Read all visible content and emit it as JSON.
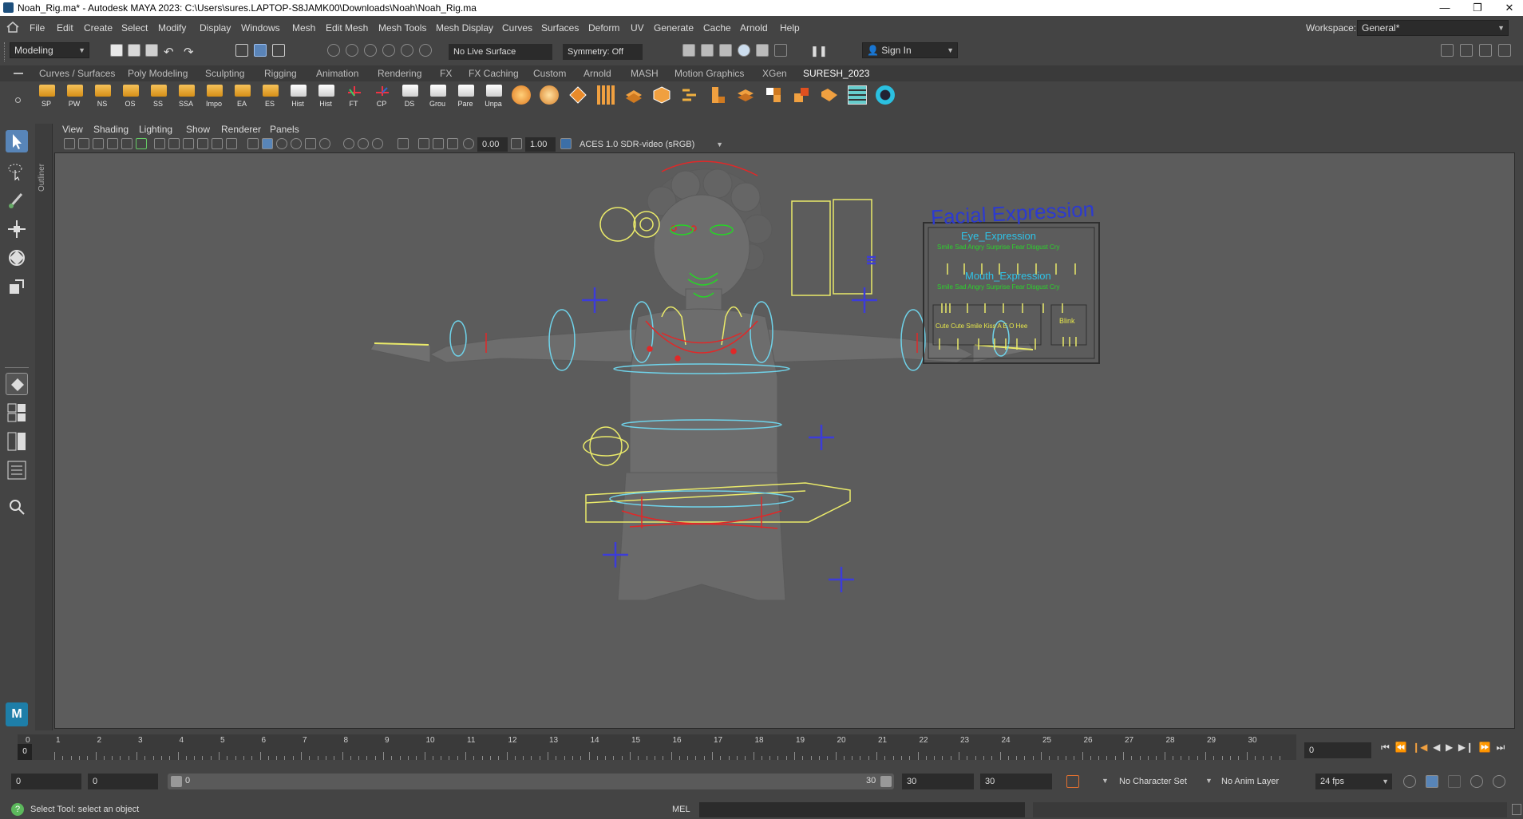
{
  "window": {
    "title": "Noah_Rig.ma* - Autodesk MAYA 2023: C:\\Users\\sures.LAPTOP-S8JAMK00\\Downloads\\Noah\\Noah_Rig.ma",
    "minimize": "—",
    "restore": "❐",
    "close": "✕"
  },
  "menus": [
    "File",
    "Edit",
    "Create",
    "Select",
    "Modify",
    "Display",
    "Windows",
    "Mesh",
    "Edit Mesh",
    "Mesh Tools",
    "Mesh Display",
    "Curves",
    "Surfaces",
    "Deform",
    "UV",
    "Generate",
    "Cache",
    "Arnold",
    "Help"
  ],
  "workspace": {
    "label": "Workspace:",
    "value": "General*"
  },
  "status": {
    "mode": "Modeling",
    "live_surface": "No Live Surface",
    "symmetry": "Symmetry: Off",
    "sign_in": "Sign In"
  },
  "shelf_tabs": [
    "Curves / Surfaces",
    "Poly Modeling",
    "Sculpting",
    "Rigging",
    "Animation",
    "Rendering",
    "FX",
    "FX Caching",
    "Custom",
    "Arnold",
    "MASH",
    "Motion Graphics",
    "XGen",
    "SURESH_2023"
  ],
  "shelf_active": "SURESH_2023",
  "shelf_buttons": [
    "SP",
    "PW",
    "NS",
    "OS",
    "SS",
    "SSA",
    "Impo",
    "EA",
    "ES",
    "Hist",
    "Hist",
    "FT",
    "CP",
    "DS",
    "Grou",
    "Pare",
    "Unpa"
  ],
  "outliner_label": "Outliner",
  "panel_menus": [
    "View",
    "Shading",
    "Lighting",
    "Show",
    "Renderer",
    "Panels"
  ],
  "panel_fields": {
    "exposure": "0.00",
    "gamma": "1.00",
    "colorspace": "ACES 1.0 SDR-video (sRGB)"
  },
  "viewport": {
    "facial_title": "Facial Expression",
    "eye_label": "Eye_Expression",
    "eye_slots": [
      "Smile",
      "Sad",
      "Angry",
      "Surprise",
      "Fear",
      "Disgust",
      "Cry"
    ],
    "mouth_label": "Mouth_Expression",
    "mouth_slots": [
      "Smile",
      "Sad",
      "Angry",
      "Surprise",
      "Fear",
      "Disgust",
      "Cry"
    ],
    "extra_slots": [
      "Cute",
      "Cute Smile",
      "Kiss",
      "A",
      "E",
      "O",
      "Hee"
    ],
    "blink_label": "Blink",
    "colors": {
      "ctrl_yellow": "#eaea6a",
      "ctrl_cyan": "#6fd3ea",
      "ctrl_red": "#e12828",
      "ctrl_green": "#27d427",
      "ctrl_blue": "#3c3cd9",
      "mesh": "#6d6d6d"
    }
  },
  "timeline": {
    "start_label": "0",
    "ticks": [
      "1",
      "2",
      "3",
      "4",
      "5",
      "6",
      "7",
      "8",
      "9",
      "10",
      "11",
      "12",
      "13",
      "14",
      "15",
      "16",
      "17",
      "18",
      "19",
      "20",
      "21",
      "22",
      "23",
      "24",
      "25",
      "26",
      "27",
      "28",
      "29",
      "30"
    ],
    "current_frame": "0"
  },
  "range": {
    "start": "0",
    "playback_start": "0",
    "slider_start": "0",
    "slider_end": "30",
    "playback_end": "30",
    "end": "30",
    "character_set": "No Character Set",
    "anim_layer": "No Anim Layer",
    "fps": "24 fps"
  },
  "help": {
    "message": "Select Tool: select an object",
    "script_lang": "MEL"
  }
}
